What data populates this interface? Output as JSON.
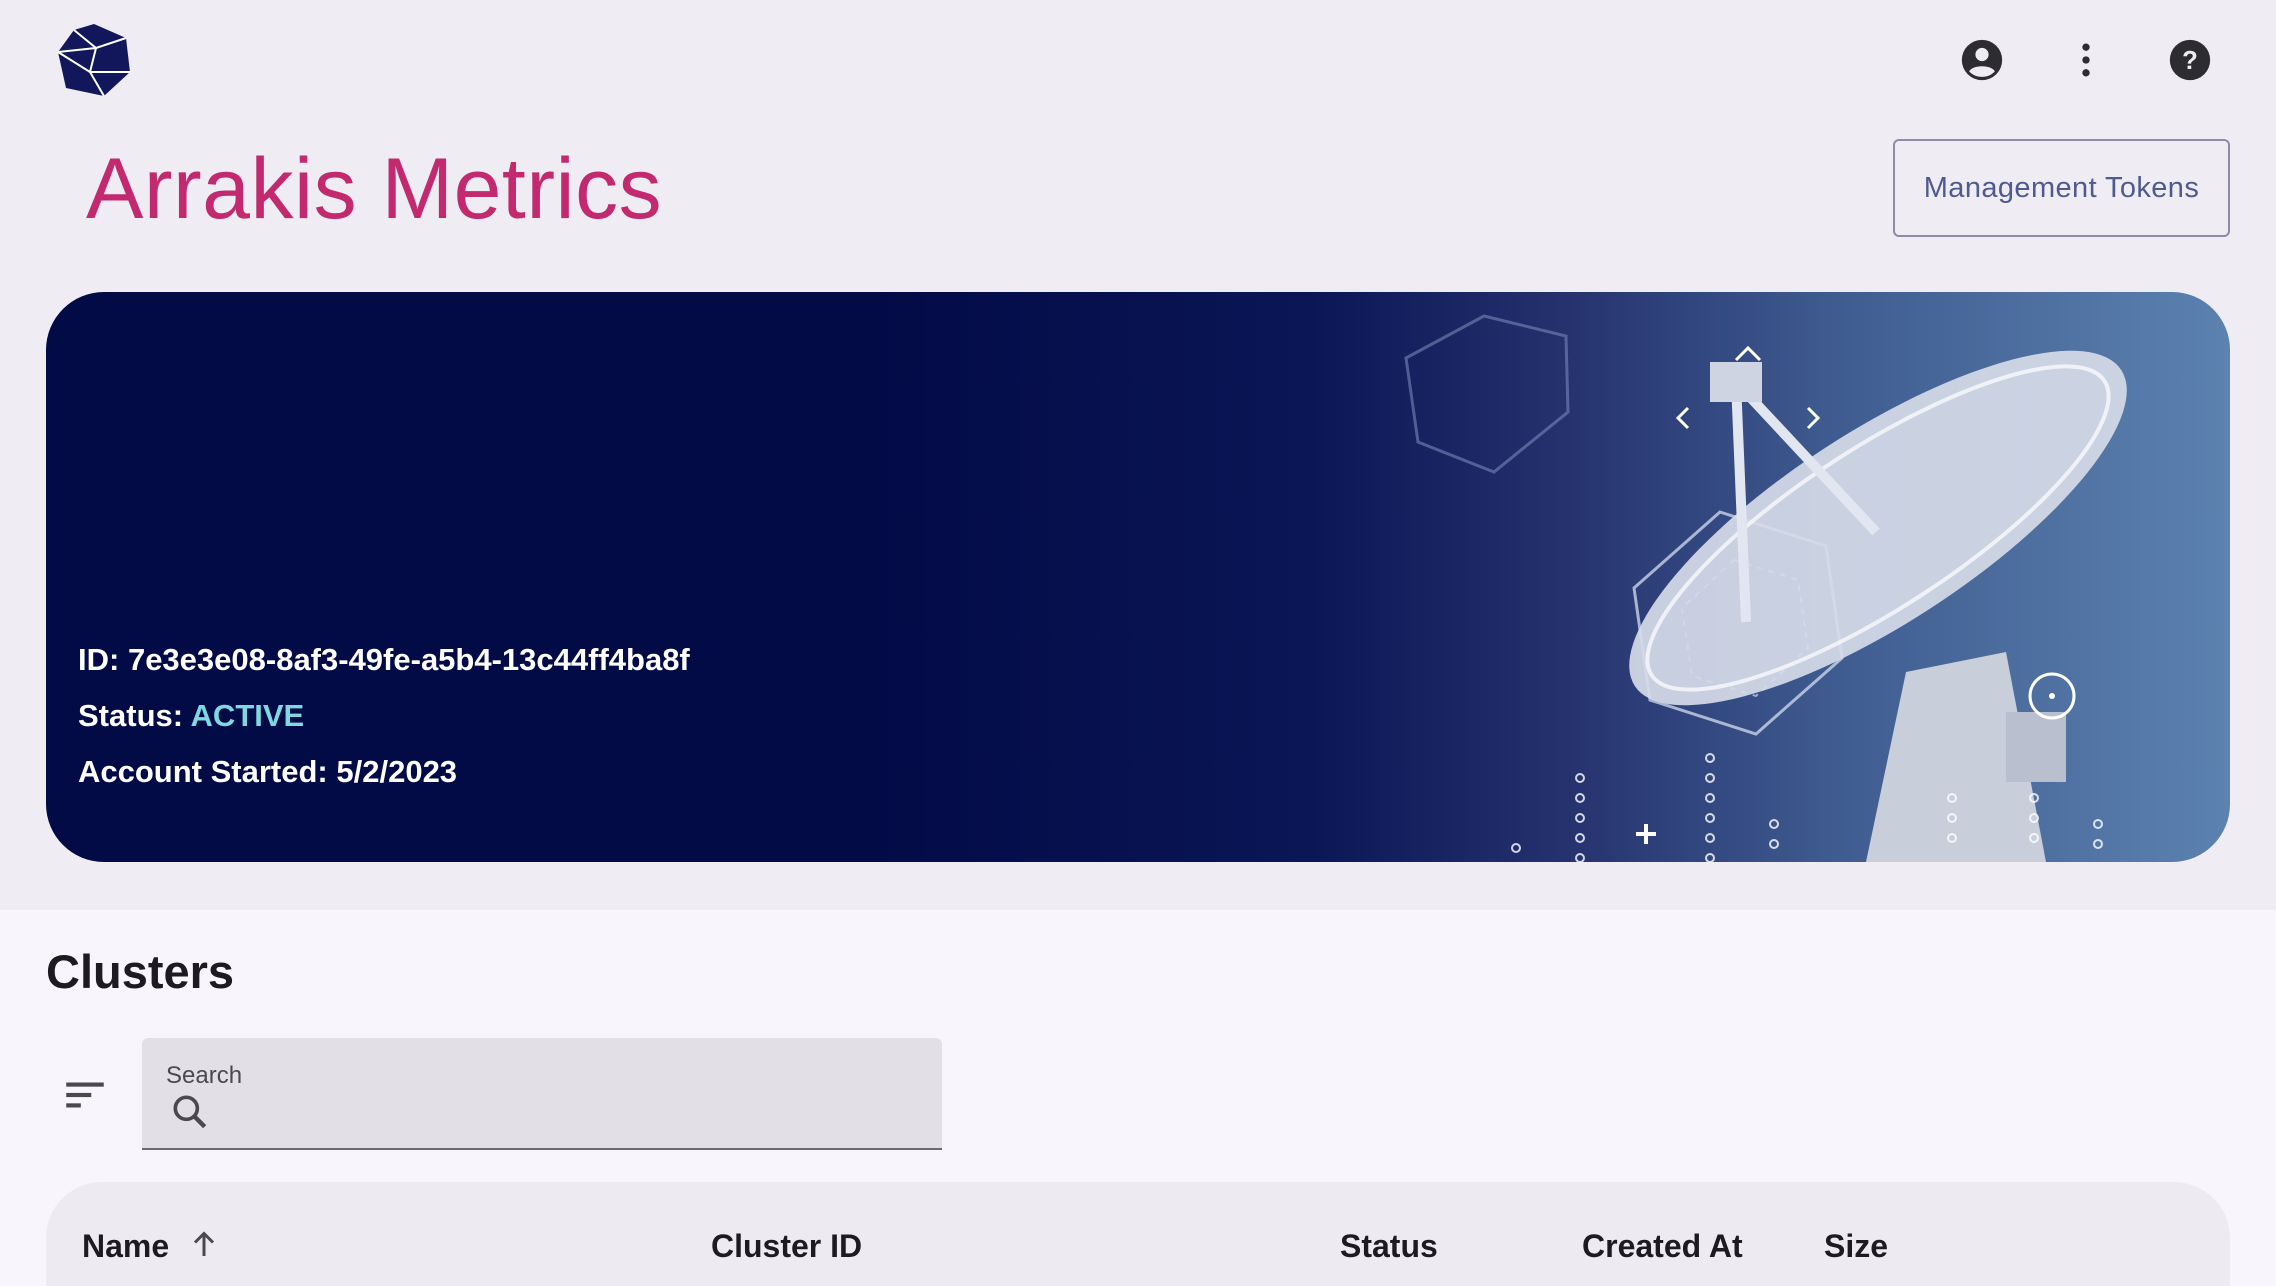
{
  "header": {
    "logo_icon": "geodesic-cube-logo",
    "icons": [
      "account-circle-icon",
      "more-vert-icon",
      "help-icon"
    ]
  },
  "page": {
    "title": "Arrakis Metrics",
    "management_tokens_label": "Management Tokens"
  },
  "banner": {
    "id_label": "ID:",
    "id_value": "7e3e3e08-8af3-49fe-a5b4-13c44ff4ba8f",
    "status_label": "Status:",
    "status_value": "ACTIVE",
    "account_started_label": "Account Started:",
    "account_started_value": "5/2/2023"
  },
  "clusters": {
    "title": "Clusters",
    "search": {
      "label": "Search",
      "value": "",
      "placeholder": ""
    },
    "columns": [
      "Name",
      "Cluster ID",
      "Status",
      "Created At",
      "Size"
    ],
    "sort": {
      "column": "Name",
      "direction": "ascending"
    }
  },
  "colors": {
    "brand_title": "#c2296f",
    "banner_bg": "#030b47",
    "status_active": "#7fd7e0",
    "button_text": "#4f5b8e"
  }
}
